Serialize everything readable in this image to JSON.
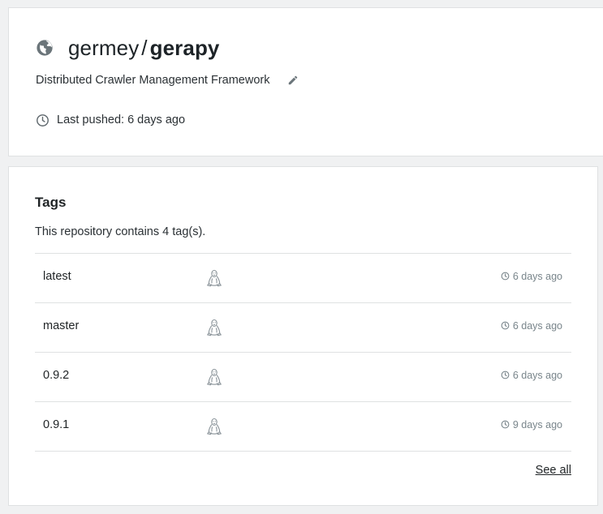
{
  "repository": {
    "namespace": "germey",
    "separator": "/",
    "name": "gerapy",
    "description": "Distributed Crawler Management Framework",
    "last_pushed": "Last pushed: 6 days ago",
    "visibility_icon": "globe-icon",
    "edit_icon": "pencil-icon"
  },
  "tags_section": {
    "heading": "Tags",
    "count_text": "This repository contains 4 tag(s).",
    "see_all": "See all",
    "rows": [
      {
        "name": "latest",
        "os_icon": "linux-icon",
        "time": "6 days ago"
      },
      {
        "name": "master",
        "os_icon": "linux-icon",
        "time": "6 days ago"
      },
      {
        "name": "0.9.2",
        "os_icon": "linux-icon",
        "time": "6 days ago"
      },
      {
        "name": "0.9.1",
        "os_icon": "linux-icon",
        "time": "9 days ago"
      }
    ]
  },
  "colors": {
    "background": "#f0f1f2",
    "card": "#ffffff",
    "border": "#dfe1e2",
    "muted_text": "#79858b"
  }
}
